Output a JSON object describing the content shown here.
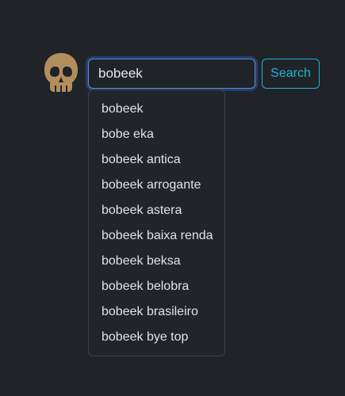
{
  "logo": {
    "icon": "skull-icon",
    "color": "#b38e5d"
  },
  "search": {
    "value": "bobeek",
    "button_label": "Search",
    "focus_color": "#5b8dd6",
    "button_color": "#1fb4d6"
  },
  "suggestions": [
    "bobeek",
    "bobe eka",
    "bobeek antica",
    "bobeek arrogante",
    "bobeek astera",
    "bobeek baixa renda",
    "bobeek beksa",
    "bobeek belobra",
    "bobeek brasileiro",
    "bobeek bye top"
  ]
}
